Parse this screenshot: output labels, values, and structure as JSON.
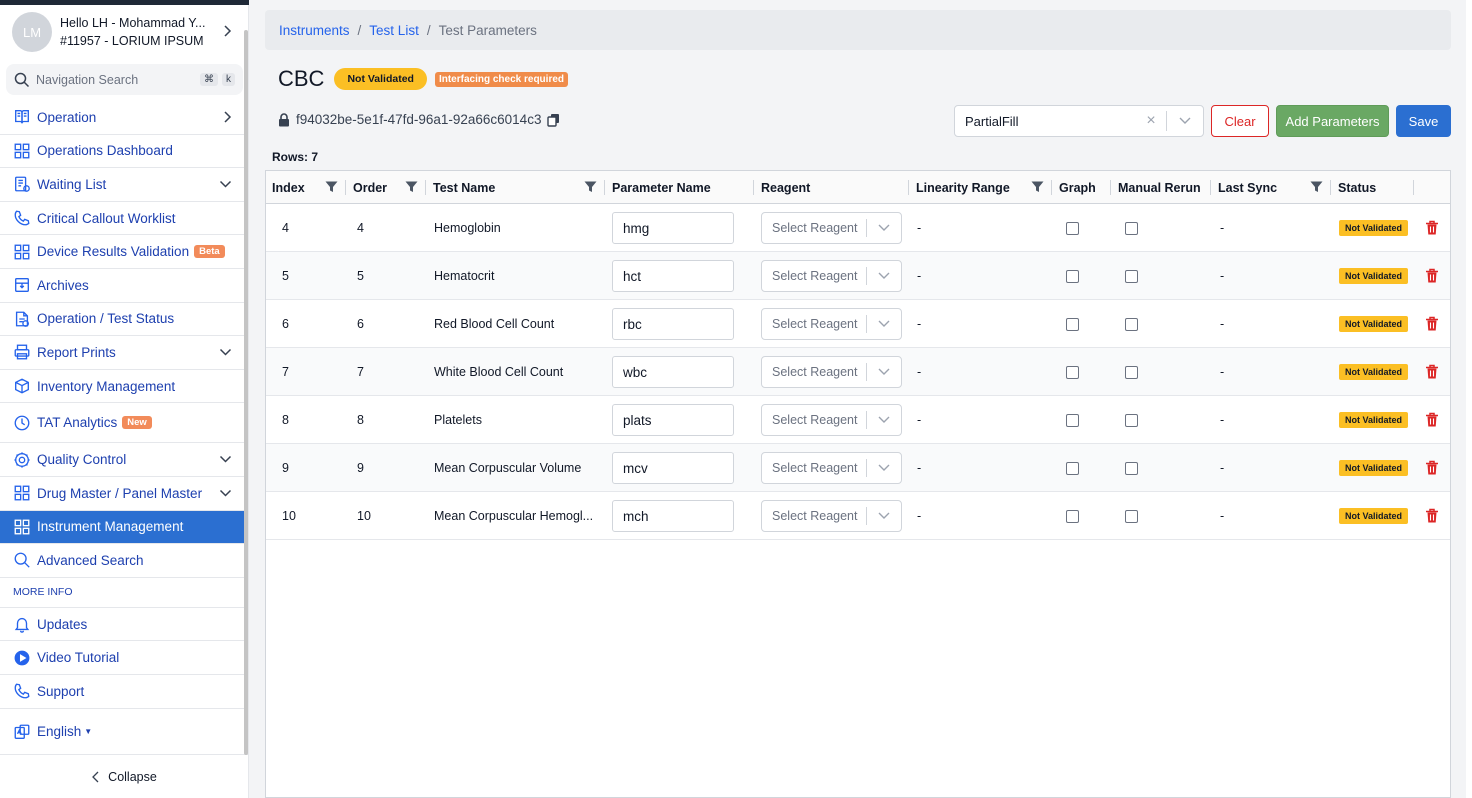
{
  "user": {
    "initials": "LM",
    "greeting": "Hello LH - Mohammad Y...",
    "account": "#11957 - LORIUM IPSUM"
  },
  "nav_search": {
    "placeholder": "Navigation Search",
    "key1": "⌘",
    "key2": "k"
  },
  "nav": [
    {
      "label": "Operation",
      "icon": "book-icon",
      "chevron": "right"
    },
    {
      "label": "Operations Dashboard",
      "icon": "grid-icon"
    },
    {
      "label": "Waiting List",
      "icon": "list-icon",
      "chevron": "down"
    },
    {
      "label": "Critical Callout Worklist",
      "icon": "phone-icon"
    },
    {
      "label": "Device Results Validation",
      "icon": "grid-icon",
      "badge": "Beta"
    },
    {
      "label": "Archives",
      "icon": "archive-icon"
    },
    {
      "label": "Operation / Test Status",
      "icon": "document-icon"
    },
    {
      "label": "Report Prints",
      "icon": "printer-icon",
      "chevron": "down"
    },
    {
      "label": "Inventory Management",
      "icon": "box-icon"
    },
    {
      "label": "TAT Analytics",
      "icon": "clock-icon",
      "badge": "New"
    },
    {
      "label": "Quality Control",
      "icon": "gear-icon",
      "chevron": "down"
    },
    {
      "label": "Drug Master / Panel Master",
      "icon": "grid-icon",
      "chevron": "down"
    },
    {
      "label": "Instrument Management",
      "icon": "grid-icon",
      "active": true
    },
    {
      "label": "Advanced Search",
      "icon": "search-icon"
    }
  ],
  "more_info_label": "MORE INFO",
  "more_nav": [
    {
      "label": "Updates",
      "icon": "bell-icon"
    },
    {
      "label": "Video Tutorial",
      "icon": "play-icon"
    },
    {
      "label": "Support",
      "icon": "phone-icon"
    }
  ],
  "language": "English",
  "collapse_label": "Collapse",
  "breadcrumb": {
    "item1": "Instruments",
    "item2": "Test List",
    "current": "Test Parameters"
  },
  "page": {
    "title": "CBC",
    "status_badge": "Not Validated",
    "warning_badge": "Interfacing check required",
    "uuid": "f94032be-5e1f-47fd-96a1-92a66c6014c3",
    "rows_label": "Rows: 7"
  },
  "controls": {
    "select_value": "PartialFill",
    "clear": "Clear",
    "add": "Add Parameters",
    "save": "Save"
  },
  "columns": [
    "Index",
    "Order",
    "Test Name",
    "Parameter Name",
    "Reagent",
    "Linearity Range",
    "Graph",
    "Manual Rerun",
    "Last Sync",
    "Status"
  ],
  "rows": [
    {
      "index": "4",
      "order": "4",
      "test": "Hemoglobin",
      "param": "hmg",
      "reagent": "Select Reagent",
      "linearity": "-",
      "sync": "-",
      "status": "Not Validated"
    },
    {
      "index": "5",
      "order": "5",
      "test": "Hematocrit",
      "param": "hct",
      "reagent": "Select Reagent",
      "linearity": "-",
      "sync": "-",
      "status": "Not Validated"
    },
    {
      "index": "6",
      "order": "6",
      "test": "Red Blood Cell Count",
      "param": "rbc",
      "reagent": "Select Reagent",
      "linearity": "-",
      "sync": "-",
      "status": "Not Validated"
    },
    {
      "index": "7",
      "order": "7",
      "test": "White Blood Cell Count",
      "param": "wbc",
      "reagent": "Select Reagent",
      "linearity": "-",
      "sync": "-",
      "status": "Not Validated"
    },
    {
      "index": "8",
      "order": "8",
      "test": "Platelets",
      "param": "plats",
      "reagent": "Select Reagent",
      "linearity": "-",
      "sync": "-",
      "status": "Not Validated"
    },
    {
      "index": "9",
      "order": "9",
      "test": "Mean Corpuscular Volume",
      "param": "mcv",
      "reagent": "Select Reagent",
      "linearity": "-",
      "sync": "-",
      "status": "Not Validated"
    },
    {
      "index": "10",
      "order": "10",
      "test": "Mean Corpuscular Hemogl...",
      "param": "mch",
      "reagent": "Select Reagent",
      "linearity": "-",
      "sync": "-",
      "status": "Not Validated"
    }
  ],
  "colors": {
    "accent": "#2b6fd1",
    "add_button": "#6aa864",
    "clear": "#dc2626",
    "status": "#fbbf24",
    "warning": "#f08c4a"
  }
}
